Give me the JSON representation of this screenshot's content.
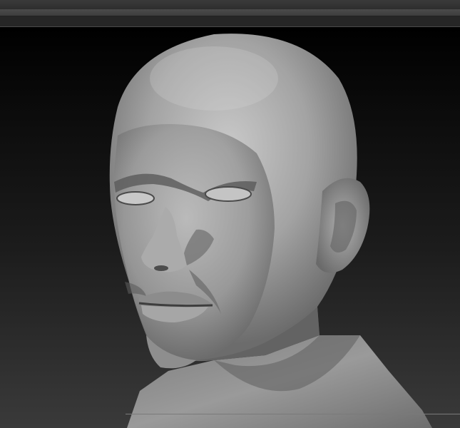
{
  "window": {
    "title": ""
  },
  "viewport": {
    "model": "sculpted-head-bust",
    "material": "matcap-gray",
    "background_top": "#000000",
    "background_bottom": "#3a3a3a",
    "model_color": "#a6a6a6"
  }
}
